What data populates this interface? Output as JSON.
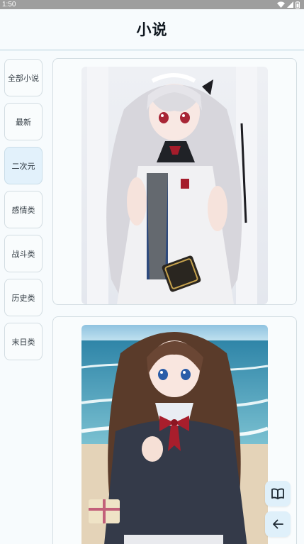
{
  "status_bar": {
    "time": "1:50",
    "icons": [
      "wifi-icon",
      "signal-icon",
      "battery-icon"
    ]
  },
  "header": {
    "title": "小说"
  },
  "sidebar": {
    "items": [
      {
        "label": "全部小说",
        "active": false
      },
      {
        "label": "最新",
        "active": false
      },
      {
        "label": "二次元",
        "active": true
      },
      {
        "label": "感情类",
        "active": false
      },
      {
        "label": "战斗类",
        "active": false
      },
      {
        "label": "历史类",
        "active": false
      },
      {
        "label": "末日类",
        "active": false
      }
    ]
  },
  "main": {
    "cards": [
      {
        "image": "anime-girl-white-hair-holding-book"
      },
      {
        "image": "anime-girl-brown-hair-beach"
      }
    ]
  },
  "floating_buttons": [
    {
      "icon": "open-book-icon"
    },
    {
      "icon": "arrow-left-icon"
    }
  ],
  "colors": {
    "background": "#f7fbfd",
    "active_category": "#e2f1fb",
    "border": "#d3dde2",
    "fab": "#dff0fa",
    "status_bar": "#9e9e9e"
  }
}
